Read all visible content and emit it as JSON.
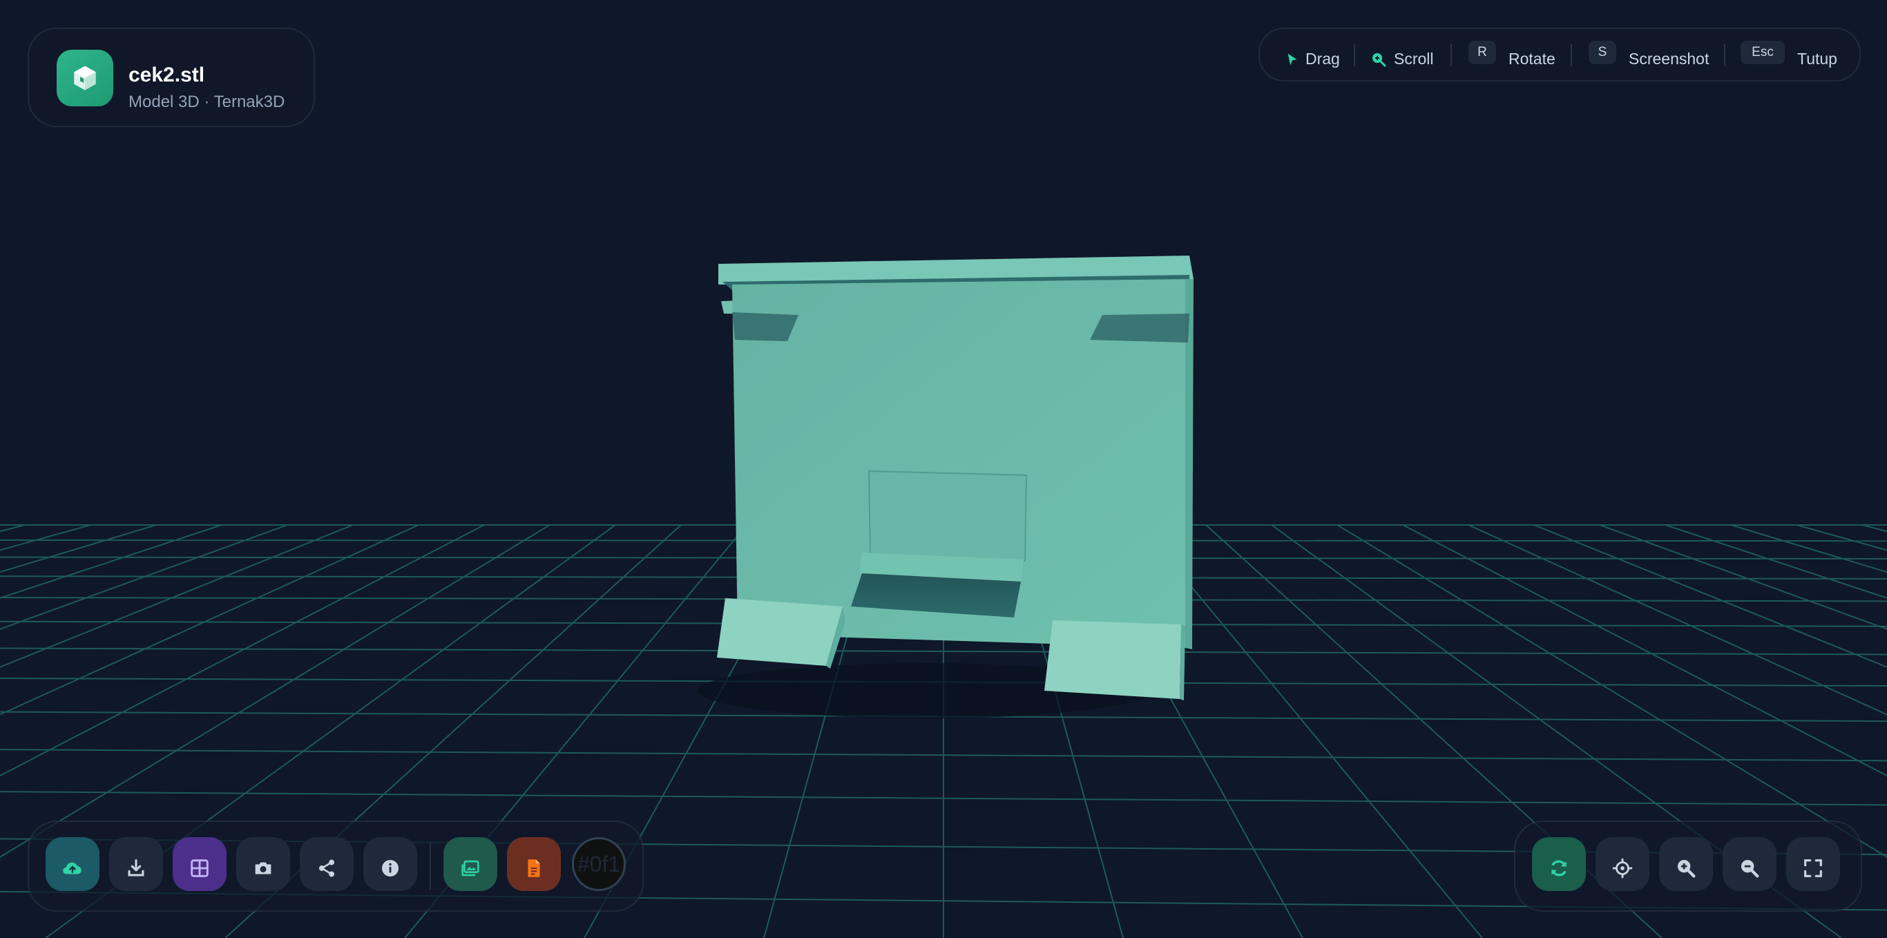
{
  "file": {
    "name": "cek2.stl",
    "meta": "Model 3D · Ternak3D"
  },
  "hints": [
    {
      "icon": "pointer-icon",
      "label": "Drag"
    },
    {
      "icon": "zoom-scroll-icon",
      "label": "Scroll"
    },
    {
      "key": "R",
      "label": "Rotate"
    },
    {
      "key": "S",
      "label": "Screenshot"
    },
    {
      "key": "Esc",
      "label": "Tutup"
    }
  ],
  "toolbar": {
    "buttons": [
      {
        "icon": "cloud-upload-icon"
      },
      {
        "icon": "download-icon"
      },
      {
        "icon": "grid-icon"
      },
      {
        "icon": "camera-icon"
      },
      {
        "icon": "share-icon"
      },
      {
        "icon": "info-icon"
      },
      {
        "icon": "image-gallery-icon"
      },
      {
        "icon": "document-icon"
      }
    ],
    "color_value": "#0f1"
  },
  "view_controls": [
    {
      "icon": "auto-rotate-icon"
    },
    {
      "icon": "crosshair-icon"
    },
    {
      "icon": "zoom-in-icon"
    },
    {
      "icon": "zoom-out-icon"
    },
    {
      "icon": "fullscreen-icon"
    }
  ],
  "colors": {
    "background": "#0f172a",
    "accent": "#2dd4a7",
    "model": "#6cb8a8",
    "grid": "#1f5f5a"
  }
}
